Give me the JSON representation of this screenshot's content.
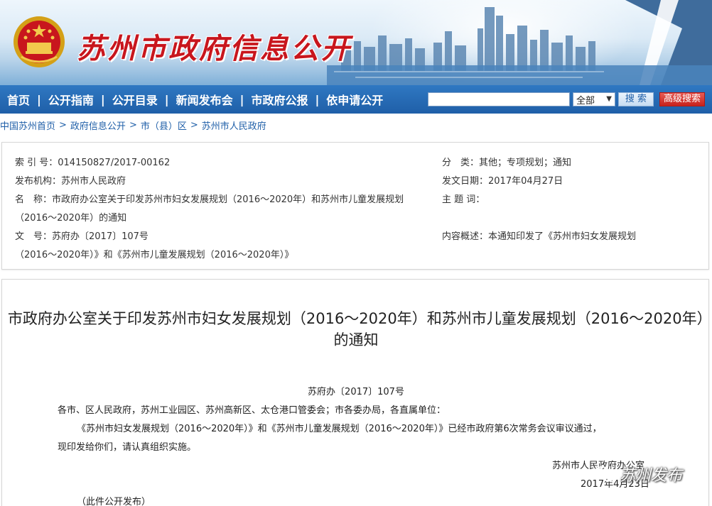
{
  "header": {
    "site_title": "苏州市政府信息公开"
  },
  "nav": {
    "items": [
      "首页",
      "公开指南",
      "公开目录",
      "新闻发布会",
      "市政府公报",
      "依申请公开"
    ],
    "separator": "|"
  },
  "search": {
    "input_value": "",
    "select_value": "全部",
    "search_label": "搜 索",
    "advanced_label": "高级搜索"
  },
  "breadcrumb": {
    "items": [
      "中国苏州首页",
      "政府信息公开",
      "市（县）区",
      "苏州市人民政府"
    ],
    "separator": ">"
  },
  "info": {
    "index_no": "索 引 号：014150827/2017-00162",
    "category": "分　类：其他；专项规划；通知",
    "publisher": "发布机构：苏州市人民政府",
    "issue_date": "发文日期：2017年04月27日",
    "name_line1": "名　称：市政府办公室关于印发苏州市妇女发展规划（2016～2020年）和苏州市儿童发展规划",
    "name_line2": "（2016～2020年）的通知",
    "subject": "主 题 词：",
    "doc_no": "文　号：苏府办〔2017〕107号",
    "summary": "内容概述：本通知印发了《苏州市妇女发展规划",
    "summary_line2": "（2016～2020年）》和《苏州市儿童发展规划（2016～2020年）》"
  },
  "document": {
    "title": "市政府办公室关于印发苏州市妇女发展规划（2016～2020年）和苏州市儿童发展规划（2016～2020年）的通知",
    "doc_number": "苏府办〔2017〕107号",
    "recipients": "各市、区人民政府，苏州工业园区、苏州高新区、太仓港口管委会；市各委办局，各直属单位：",
    "body_line1": "《苏州市妇女发展规划（2016～2020年）》和《苏州市儿童发展规划（2016～2020年）》已经市政府第6次常务会议审议通过，",
    "body_line2": "现印发给你们，请认真组织实施。",
    "signature": "苏州市人民政府办公室",
    "date": "2017年4月23日",
    "note": "（此件公开发布）"
  },
  "watermark": {
    "text": "苏州发布"
  },
  "colors": {
    "nav_blue": "#1f5fa8",
    "title_red": "#c8161d",
    "advanced_red": "#c8221c"
  }
}
